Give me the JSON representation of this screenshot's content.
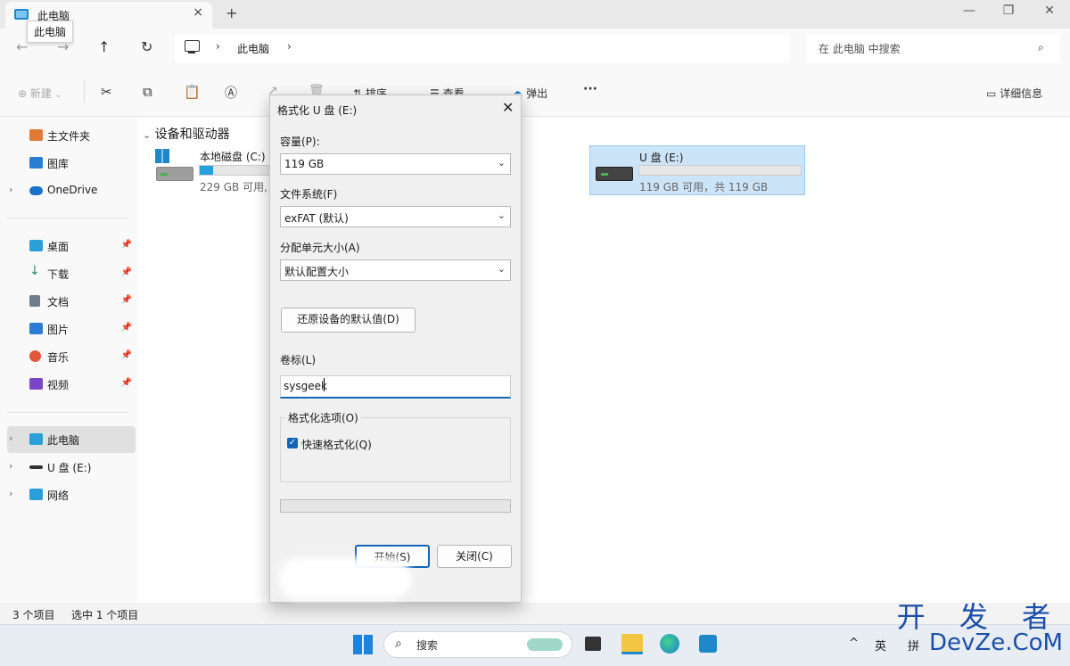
{
  "window": {
    "tab_title": "此电脑",
    "tooltip": "此电脑",
    "new_tab": "+",
    "tab_close": "×",
    "minimize": "—",
    "maximize": "❐",
    "close": "✕"
  },
  "address": {
    "crumbs": [
      "此电脑"
    ],
    "search_placeholder": "在 此电脑 中搜索"
  },
  "toolbar": {
    "new_label": "新建",
    "sort_label": "排序",
    "view_label": "查看",
    "eject_label": "弹出",
    "more_label": "···",
    "details_label": "详细信息"
  },
  "sidebar": {
    "items": [
      {
        "label": "主文件夹",
        "icon": "home-icon",
        "color": "#e07a35"
      },
      {
        "label": "图库",
        "icon": "gallery-icon",
        "color": "#2b7dd1"
      },
      {
        "label": "OneDrive",
        "icon": "cloud-icon",
        "color": "#1a73c9"
      },
      {
        "label": "桌面",
        "icon": "desktop-icon",
        "color": "#2a9fd8"
      },
      {
        "label": "下载",
        "icon": "download-icon",
        "color": "#1f8f5a"
      },
      {
        "label": "文档",
        "icon": "document-icon",
        "color": "#6f7d8c"
      },
      {
        "label": "图片",
        "icon": "picture-icon",
        "color": "#2b7dd1"
      },
      {
        "label": "音乐",
        "icon": "music-icon",
        "color": "#e0573c"
      },
      {
        "label": "视频",
        "icon": "video-icon",
        "color": "#7b45c9"
      },
      {
        "label": "此电脑",
        "icon": "pc-icon",
        "color": "#2a9fd8"
      },
      {
        "label": "U 盘 (E:)",
        "icon": "usb-drive-icon",
        "color": "#333333"
      },
      {
        "label": "网络",
        "icon": "network-icon",
        "color": "#2a9fd8"
      }
    ]
  },
  "main": {
    "group_header": "设备和驱动器",
    "drives": [
      {
        "name": "本地磁盘 (C:)",
        "info": "229 GB 可用,",
        "used_fraction": 0.09
      },
      {
        "name": "U 盘 (E:)",
        "info": "119 GB 可用，共 119 GB",
        "used_fraction": 0.0
      }
    ]
  },
  "status": {
    "count": "3 个项目",
    "selected": "选中 1 个项目"
  },
  "dialog": {
    "title": "格式化 U 盘 (E:)",
    "capacity_label": "容量(P):",
    "capacity_value": "119 GB",
    "filesystem_label": "文件系统(F)",
    "filesystem_value": "exFAT (默认)",
    "alloc_label": "分配单元大小(A)",
    "alloc_value": "默认配置大小",
    "restore_button": "还原设备的默认值(D)",
    "volume_label": "卷标(L)",
    "volume_value": "sysgeek",
    "options_label": "格式化选项(O)",
    "quick_format_label": "快速格式化(Q)",
    "quick_format_checked": true,
    "start_button": "开始(S)",
    "close_button": "关闭(C)"
  },
  "taskbar": {
    "search_label": "搜索",
    "tray_lang1": "英",
    "tray_lang2": "拼"
  },
  "watermark": {
    "line1": "开 发 者",
    "line2": "DevZe.CoM"
  }
}
